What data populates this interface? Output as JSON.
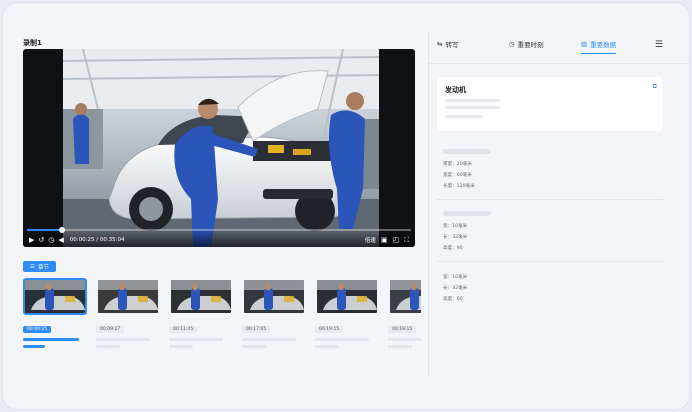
{
  "recording": {
    "title": "录制1"
  },
  "player": {
    "current_time": "00:00:25",
    "total_time": "00:35:04",
    "time_separator": "/",
    "progress": 0.09,
    "speed_label": "倍速"
  },
  "chapters": {
    "button_label": "章节",
    "items": [
      {
        "time": "00:00:25",
        "active": true
      },
      {
        "time": "00:09:27",
        "active": false
      },
      {
        "time": "00:11:45",
        "active": false
      },
      {
        "time": "00:17:65",
        "active": false
      },
      {
        "time": "00:19:15",
        "active": false
      },
      {
        "time": "00:18:15",
        "active": false
      }
    ]
  },
  "tabs": [
    {
      "label": "转写",
      "icon": "translate-icon",
      "active": false
    },
    {
      "label": "重要时刻",
      "icon": "clock-icon",
      "active": false
    },
    {
      "label": "重要数据",
      "icon": "chart-icon",
      "active": true
    }
  ],
  "card": {
    "title": "发动机"
  },
  "sections": [
    {
      "rows": [
        "厚度：20毫米",
        "宽度：60毫米",
        "长度：120毫米"
      ]
    },
    {
      "rows": [
        "宽：10毫米",
        "长：32毫米",
        "高度：90"
      ]
    },
    {
      "rows": [
        "宽：10毫米",
        "长：32毫米",
        "高度：60"
      ]
    }
  ],
  "colors": {
    "accent": "#2f8cf6",
    "background": "#f3f5f9"
  }
}
